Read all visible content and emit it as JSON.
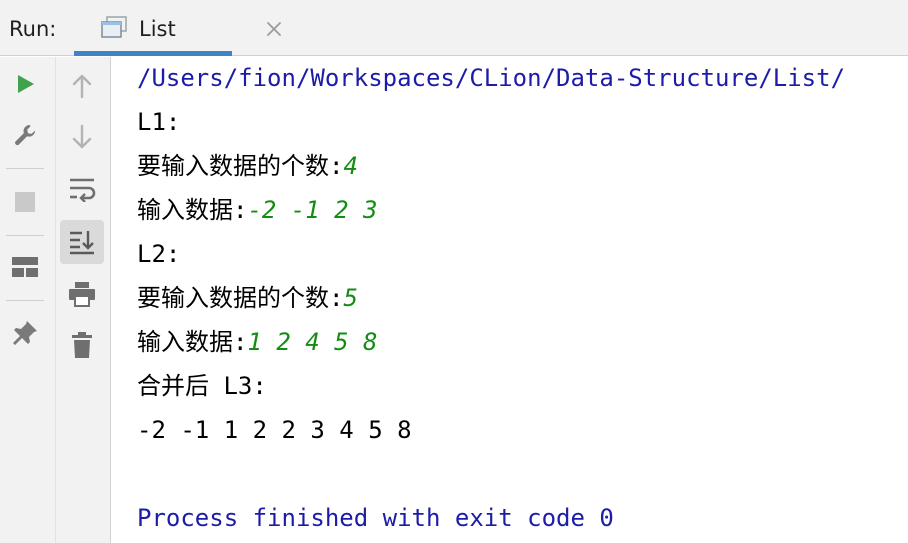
{
  "run": {
    "label": "Run:",
    "tab": {
      "label": "List"
    }
  },
  "toolbar": {
    "left": [
      {
        "icon": "run-icon",
        "interactable": true
      },
      {
        "icon": "wrench-icon",
        "interactable": true
      },
      {
        "icon": "stop-icon",
        "interactable": true
      },
      {
        "icon": "layout-icon",
        "interactable": true
      },
      {
        "icon": "pin-icon",
        "interactable": true
      }
    ],
    "mid": [
      {
        "icon": "arrow-up-icon",
        "interactable": true
      },
      {
        "icon": "arrow-down-icon",
        "interactable": true
      },
      {
        "icon": "soft-wrap-icon",
        "interactable": true
      },
      {
        "icon": "scroll-to-end-icon",
        "interactable": true,
        "active": true
      },
      {
        "icon": "print-icon",
        "interactable": true
      },
      {
        "icon": "trash-icon",
        "interactable": true
      }
    ]
  },
  "console": {
    "path": "/Users/fion/Workspaces/CLion/Data-Structure/List/",
    "l1_label": "L1:",
    "l1_count_prompt": "要输入数据的个数:",
    "l1_count_value": "4",
    "l1_data_prompt": "输入数据:",
    "l1_data_value": "-2 -1 2 3",
    "l2_label": "L2:",
    "l2_count_prompt": "要输入数据的个数:",
    "l2_count_value": "5",
    "l2_data_prompt": "输入数据:",
    "l2_data_value": "1 2 4 5 8",
    "merge_label": "合并后 L3:",
    "merge_result": "-2 -1 1 2 2 3 4 5 8",
    "process_finished": "Process finished with exit code 0"
  },
  "colors": {
    "path_blue": "#1c1ca8",
    "input_green": "#148c14",
    "run_green": "#3fa34d",
    "tab_underline": "#4083c9"
  }
}
